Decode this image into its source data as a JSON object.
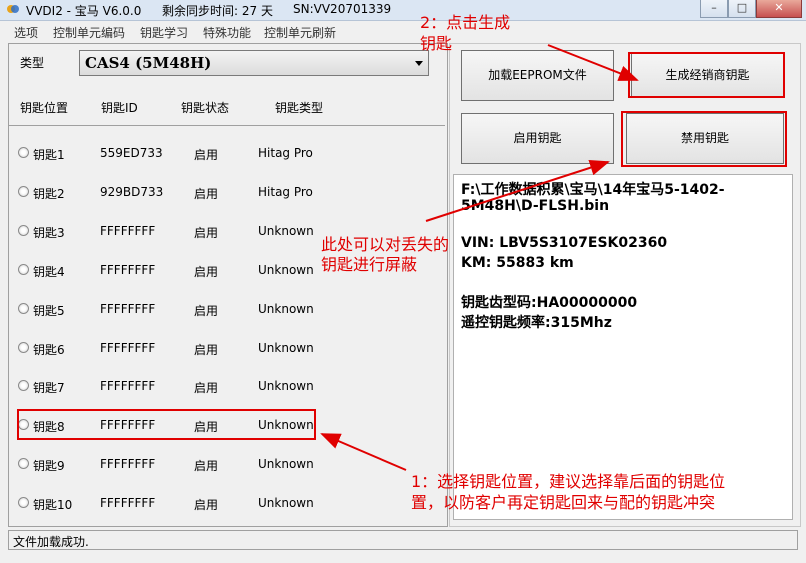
{
  "window": {
    "app_name": "VVDI2 - 宝马 V6.0.0",
    "sync_label": "剩余同步时间: 27 天",
    "serial": "SN:VV20701339"
  },
  "menu": [
    "选项",
    "控制单元编码",
    "钥匙学习",
    "特殊功能",
    "控制单元刷新"
  ],
  "type_selector": {
    "label": "类型",
    "value": "CAS4 (5M48H)"
  },
  "table": {
    "headers": [
      "钥匙位置",
      "钥匙ID",
      "钥匙状态",
      "钥匙类型"
    ],
    "rows": [
      {
        "pos": "钥匙1",
        "id": "559ED733",
        "status": "启用",
        "type": "Hitag Pro"
      },
      {
        "pos": "钥匙2",
        "id": "929BD733",
        "status": "启用",
        "type": "Hitag Pro"
      },
      {
        "pos": "钥匙3",
        "id": "FFFFFFFF",
        "status": "启用",
        "type": "Unknown"
      },
      {
        "pos": "钥匙4",
        "id": "FFFFFFFF",
        "status": "启用",
        "type": "Unknown"
      },
      {
        "pos": "钥匙5",
        "id": "FFFFFFFF",
        "status": "启用",
        "type": "Unknown"
      },
      {
        "pos": "钥匙6",
        "id": "FFFFFFFF",
        "status": "启用",
        "type": "Unknown"
      },
      {
        "pos": "钥匙7",
        "id": "FFFFFFFF",
        "status": "启用",
        "type": "Unknown"
      },
      {
        "pos": "钥匙8",
        "id": "FFFFFFFF",
        "status": "启用",
        "type": "Unknown"
      },
      {
        "pos": "钥匙9",
        "id": "FFFFFFFF",
        "status": "启用",
        "type": "Unknown"
      },
      {
        "pos": "钥匙10",
        "id": "FFFFFFFF",
        "status": "启用",
        "type": "Unknown"
      }
    ]
  },
  "buttons": {
    "load_eeprom": "加载EEPROM文件",
    "generate_dealer_key": "生成经销商钥匙",
    "enable_key": "启用钥匙",
    "disable_key": "禁用钥匙"
  },
  "info": {
    "file_line1": "F:\\工作数据积累\\宝马\\14年宝马5-1402-",
    "file_line2": "5M48H\\D-FLSH.bin",
    "vin": "VIN: LBV5S3107ESK02360",
    "km": "KM:  55883 km",
    "key_code": "钥匙齿型码:HA00000000",
    "remote_freq": "遥控钥匙频率:315Mhz"
  },
  "annotations": {
    "step2_line1": "2：点击生成",
    "step2_line2": "钥匙",
    "mask_line1": "此处可以对丢失的",
    "mask_line2": "钥匙进行屏蔽",
    "step1_line1": "1：选择钥匙位置，建议选择靠后面的钥匙位",
    "step1_line2": "置，以防客户再定钥匙回来与配的钥匙冲突"
  },
  "status": "文件加载成功.",
  "colors": {
    "annotation_red": "#e00000"
  }
}
